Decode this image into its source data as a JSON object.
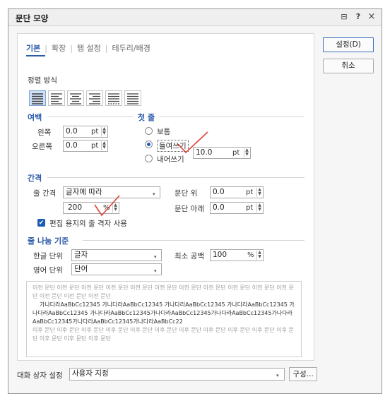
{
  "window": {
    "title": "문단 모양",
    "help_icon": "?",
    "close_icon": "×",
    "menu_icon": "⊟"
  },
  "tabs": [
    {
      "label": "기본",
      "active": true
    },
    {
      "label": "확장"
    },
    {
      "label": "탭 설정"
    },
    {
      "label": "테두리/배경"
    }
  ],
  "alignment": {
    "title": "정렬 방식"
  },
  "margin": {
    "title": "여백",
    "left_label": "왼쪽",
    "left_value": "0.0",
    "left_unit": "pt",
    "right_label": "오른쪽",
    "right_value": "0.0",
    "right_unit": "pt"
  },
  "first_line": {
    "title": "첫 줄",
    "normal_label": "보통",
    "indent_label": "들여쓰기",
    "outdent_label": "내어쓰기",
    "value": "10.0",
    "unit": "pt",
    "selected": "indent"
  },
  "spacing": {
    "title": "간격",
    "line_spacing_label": "줄 간격",
    "line_spacing_type": "글자에 따라",
    "line_spacing_value": "200",
    "line_spacing_unit": "%",
    "before_label": "문단 위",
    "before_value": "0.0",
    "before_unit": "pt",
    "after_label": "문단 아래",
    "after_value": "0.0",
    "after_unit": "pt",
    "grid_checkbox_label": "편집 용지의 줄 격자 사용",
    "grid_checked": true
  },
  "line_break": {
    "title": "줄 나눔 기준",
    "hangul_label": "한글 단위",
    "hangul_value": "글자",
    "english_label": "영어 단위",
    "english_value": "단어",
    "min_space_label": "최소 공백",
    "min_space_value": "100",
    "min_space_unit": "%"
  },
  "preview": {
    "before_text": "이전 문단 이전 문단 이전 문단 이전 문단 이전 문단 이전 문단 이전 문단 이전 문단 이전 문단 이전 문단 이전 문단 이전 문단 이전 문단 이전 문단",
    "main_text": "가나다라AaBbCc12345 가나다라AaBbCc12345 가나다라AaBbCc12345 가나다라AaBbCc12345 가나다라AaBbCc12345 가나다라AaBbCc12345가나다라AaBbCc12345가나다라AaBbCc12345가나다라AaBbCc12345가나다라AaBbCc12345가나다라AaBbCc22",
    "after_text": "이후 문단 이후 문단 이후 문단 이후 문단 이후 문단 이후 문단 이후 문단 이후 문단 이후 문단 이후 문단 이후 문단 이후 문단 이후 문단 이후 문단"
  },
  "footer": {
    "dialog_setting_label": "대화 상자 설정",
    "dialog_setting_value": "사용자 지정",
    "compose_button": "구성..."
  },
  "buttons": {
    "ok": "설정(D)",
    "cancel": "취소"
  },
  "colors": {
    "accent": "#2a5aa8",
    "check_annotation": "#e0413a"
  }
}
